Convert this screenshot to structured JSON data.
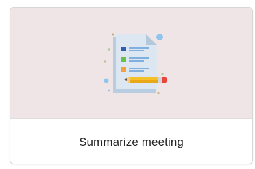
{
  "card": {
    "label": "Summarize meeting",
    "illustration_icon": "document-pencil-icon"
  },
  "colors": {
    "media_background": "#efe4e6",
    "label_text": "#242424"
  }
}
